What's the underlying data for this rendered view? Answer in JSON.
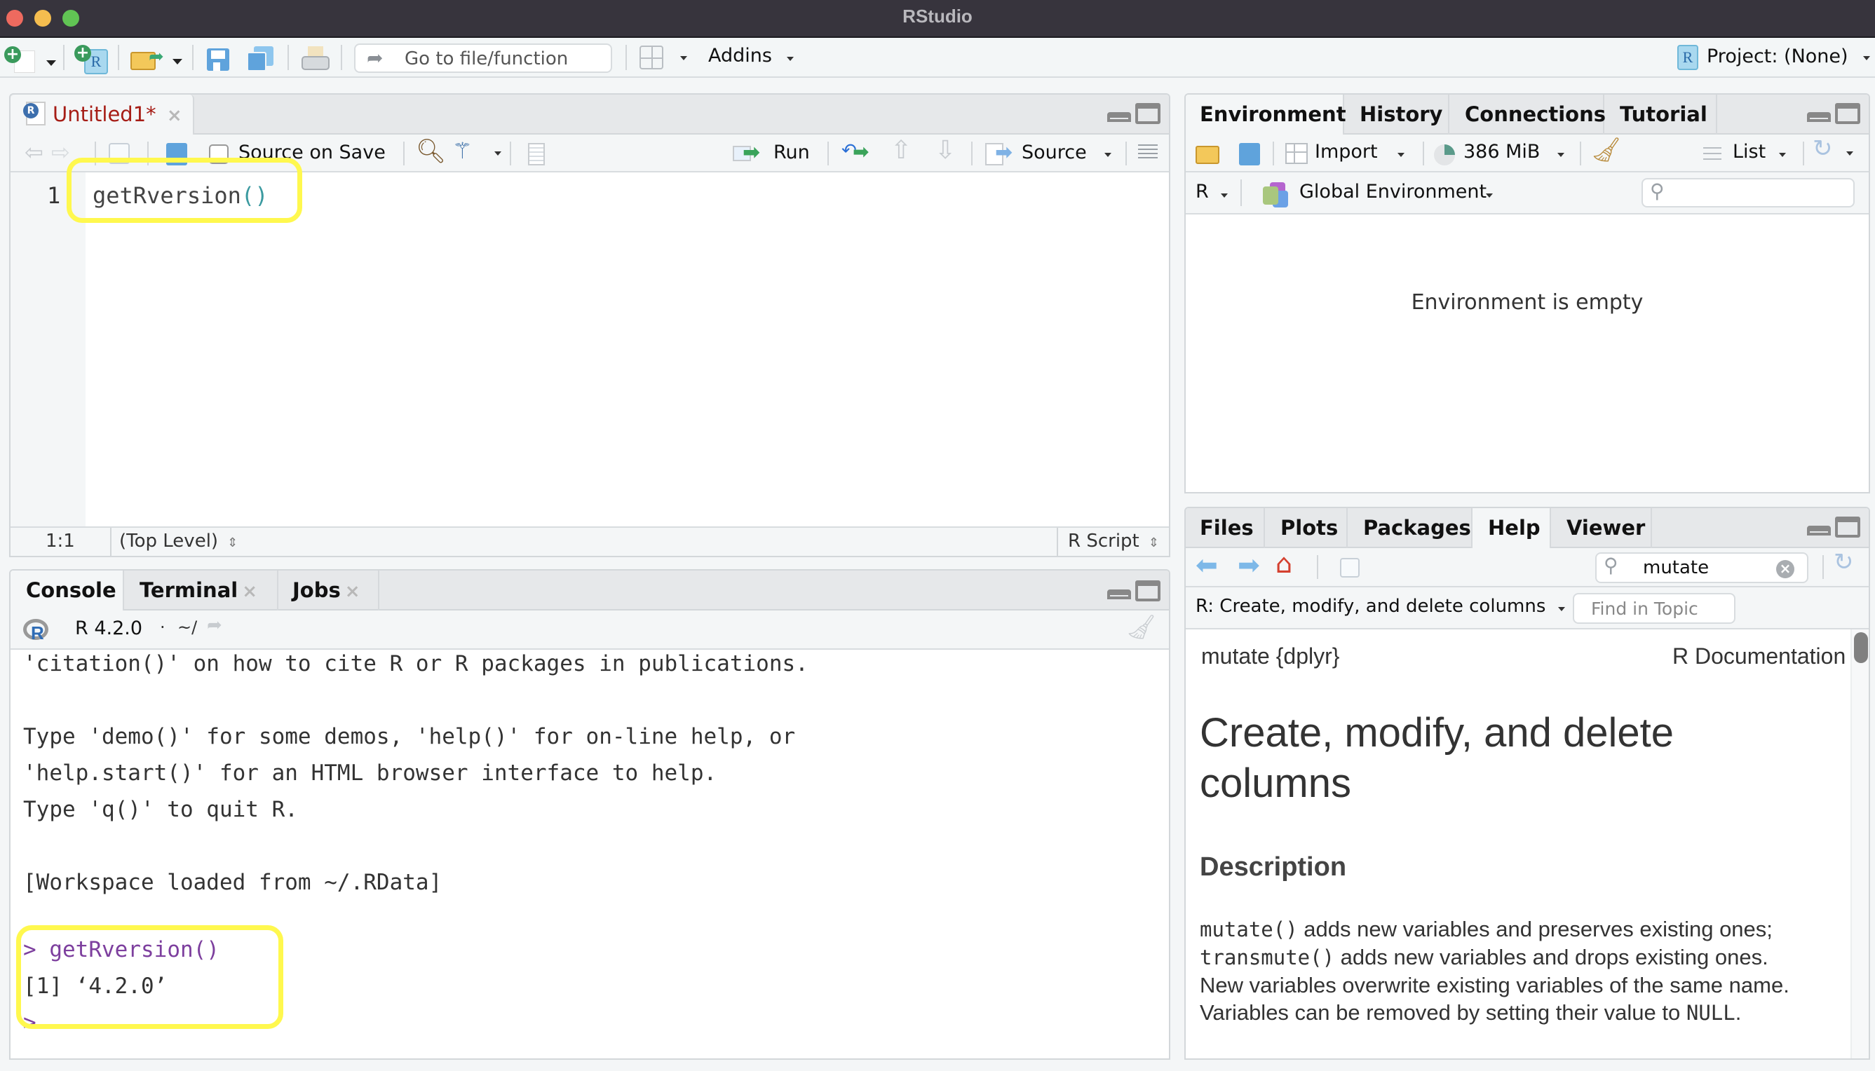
{
  "window": {
    "title": "RStudio",
    "traffic_lights": {
      "close": "#ee6a5f",
      "minimize": "#f5bd4f",
      "zoom": "#61c454"
    }
  },
  "main_toolbar": {
    "goto_placeholder": "Go to file/function",
    "addins_label": "Addins",
    "project_label": "Project: (None)",
    "icons": [
      "new-file-icon",
      "new-project-icon",
      "open-file-icon",
      "save-icon",
      "save-all-icon",
      "print-icon",
      "pane-layout-icon"
    ]
  },
  "editor": {
    "tab_label": "Untitled1*",
    "tab_color": "#a61d16",
    "source_on_save_label": "Source on Save",
    "source_on_save_checked": false,
    "run_label": "Run",
    "source_label": "Source",
    "lines": [
      {
        "number": "1",
        "code": "getRversion",
        "parens": "()"
      }
    ],
    "status": {
      "position": "1:1",
      "scope": "(Top Level)",
      "file_type": "R Script"
    }
  },
  "console": {
    "tabs": [
      {
        "label": "Console",
        "active": true,
        "closable": false
      },
      {
        "label": "Terminal",
        "active": false,
        "closable": true
      },
      {
        "label": "Jobs",
        "active": false,
        "closable": true
      }
    ],
    "r_version_label": "R 4.2.0",
    "working_dir": "~/",
    "output_lines": [
      "'citation()' on how to cite R or R packages in publications.",
      "",
      "Type 'demo()' for some demos, 'help()' for on-line help, or",
      "'help.start()' for an HTML browser interface to help.",
      "Type 'q()' to quit R.",
      "",
      "[Workspace loaded from ~/.RData]",
      ""
    ],
    "command": {
      "prompt": ">",
      "input": "getRversion()"
    },
    "result": "[1] ‘4.2.0’",
    "prompt_color": "#7d3f9e"
  },
  "environment": {
    "tabs": [
      {
        "label": "Environment",
        "active": true
      },
      {
        "label": "History",
        "active": false
      },
      {
        "label": "Connections",
        "active": false
      },
      {
        "label": "Tutorial",
        "active": false
      }
    ],
    "import_label": "Import",
    "memory_label": "386 MiB",
    "view_label": "List",
    "language": "R",
    "scope_label": "Global Environment",
    "search_placeholder": "",
    "empty_message": "Environment is empty"
  },
  "help": {
    "tabs": [
      {
        "label": "Files",
        "active": false
      },
      {
        "label": "Plots",
        "active": false
      },
      {
        "label": "Packages",
        "active": false
      },
      {
        "label": "Help",
        "active": true
      },
      {
        "label": "Viewer",
        "active": false
      }
    ],
    "search_value": "mutate",
    "topic_label": "R: Create, modify, and delete columns",
    "find_placeholder": "Find in Topic",
    "doc": {
      "header_left": "mutate {dplyr}",
      "header_right": "R Documentation",
      "title": "Create, modify, and delete columns",
      "section": "Description",
      "para": [
        {
          "code": "mutate()",
          "text": " adds new variables and preserves existing ones;"
        },
        {
          "code": "transmute()",
          "text": " adds new variables and drops existing ones."
        },
        {
          "code": "",
          "text": "New variables overwrite existing variables of the same name."
        },
        {
          "code": "",
          "text": "Variables can be removed by setting their value to ",
          "code_after": "NULL",
          "tail": "."
        }
      ]
    }
  },
  "annotations": {
    "highlight_color": "#fff84e"
  }
}
